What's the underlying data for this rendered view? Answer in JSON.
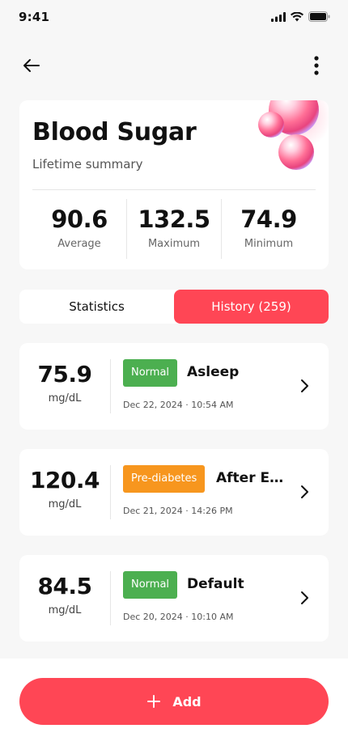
{
  "status_bar": {
    "time": "9:41"
  },
  "summary": {
    "title": "Blood Sugar",
    "subtitle": "Lifetime summary",
    "stats": [
      {
        "value": "90.6",
        "label": "Average"
      },
      {
        "value": "132.5",
        "label": "Maximum"
      },
      {
        "value": "74.9",
        "label": "Minimum"
      }
    ]
  },
  "tabs": [
    {
      "label": "Statistics",
      "active": false
    },
    {
      "label": "History (259)",
      "active": true
    }
  ],
  "records": [
    {
      "value": "75.9",
      "unit": "mg/dL",
      "badge": "Normal",
      "badge_color": "#4caf50",
      "type": "Asleep",
      "date": "Dec 22, 2024",
      "time": "10:54 AM"
    },
    {
      "value": "120.4",
      "unit": "mg/dL",
      "badge": "Pre-diabetes",
      "badge_color": "#f7961e",
      "type": "After Ea...",
      "date": "Dec 21, 2024",
      "time": "14:26 PM"
    },
    {
      "value": "84.5",
      "unit": "mg/dL",
      "badge": "Normal",
      "badge_color": "#4caf50",
      "type": "Default",
      "date": "Dec 20, 2024",
      "time": "10:10 AM"
    }
  ],
  "footer": {
    "add_label": "Add"
  },
  "colors": {
    "accent": "#ff4655",
    "normal": "#4caf50",
    "prediabetes": "#f7961e"
  },
  "icons": [
    "back-arrow-icon",
    "more-vertical-icon",
    "chevron-right-icon",
    "plus-icon",
    "signal-icon",
    "wifi-icon",
    "battery-icon"
  ]
}
